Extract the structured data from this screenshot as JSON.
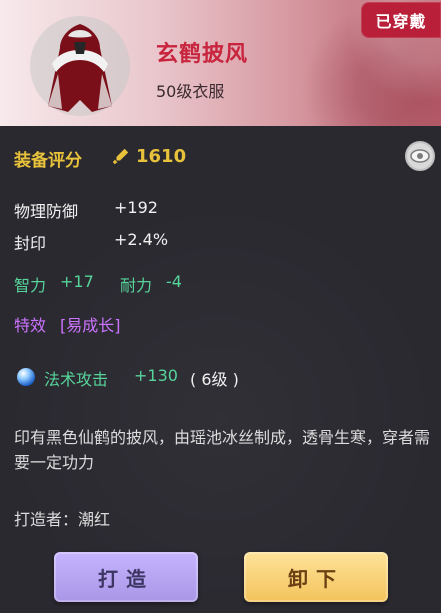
{
  "header": {
    "item_name": "玄鹤披风",
    "item_type": "50级衣服",
    "worn_badge": "已穿戴"
  },
  "score": {
    "label": "装备评分",
    "value": "1610"
  },
  "stats": [
    {
      "name": "物理防御",
      "value": "+192"
    },
    {
      "name": "封印",
      "value": "+2.4%"
    }
  ],
  "green_stats": [
    {
      "name": "智力",
      "value": "+17"
    },
    {
      "name": "耐力",
      "value": "-4"
    }
  ],
  "special": {
    "label": "特效",
    "value": "[易成长]"
  },
  "skill": {
    "name": "法术攻击",
    "value": "+130",
    "level": "( 6级 )"
  },
  "description": "印有黑色仙鹤的披风，由瑶池冰丝制成，透骨生寒，穿者需要一定功力",
  "maker": "打造者：潮红",
  "buttons": {
    "make": "打造",
    "unequip": "卸下"
  }
}
